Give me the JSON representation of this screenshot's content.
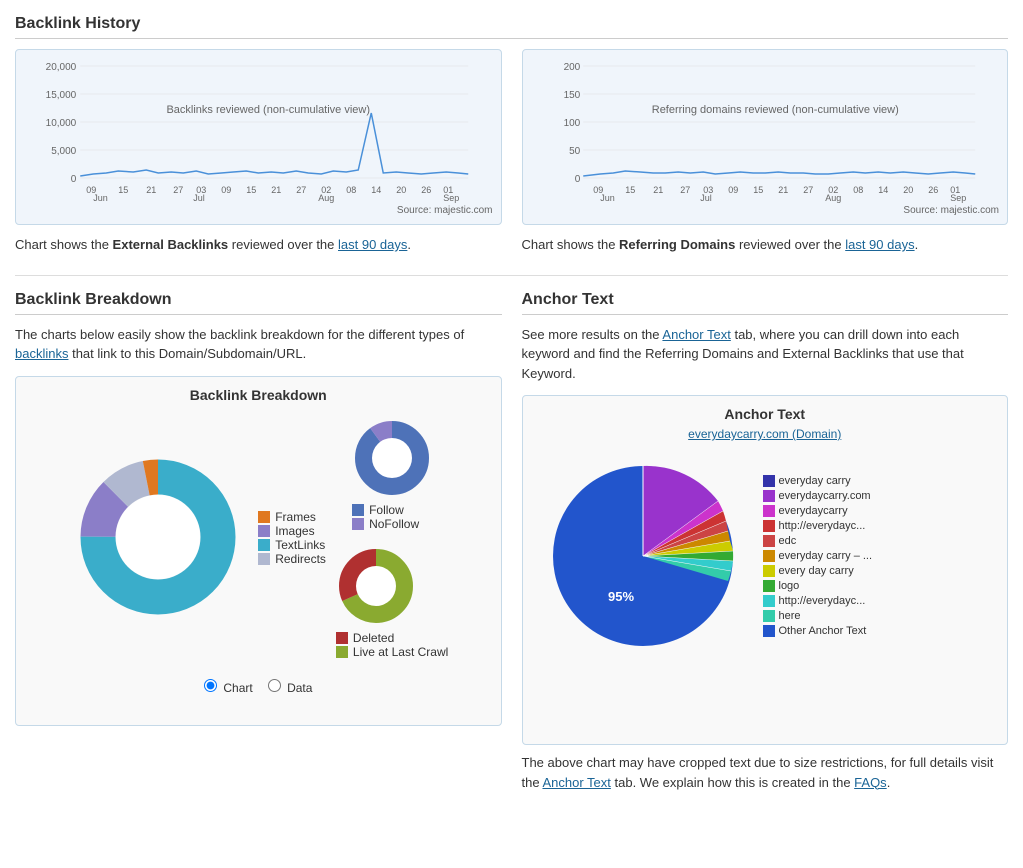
{
  "page": {
    "backlink_history_title": "Backlink History",
    "backlink_breakdown_title": "Backlink Breakdown",
    "anchor_text_title": "Anchor Text",
    "left_chart": {
      "title": "Backlinks reviewed (non-cumulative view)",
      "source": "Source: majestic.com",
      "y_labels": [
        "20,000",
        "15,000",
        "10,000",
        "5,000",
        "0"
      ],
      "desc": "Chart shows the ",
      "desc_bold": "External Backlinks",
      "desc_mid": " reviewed over the ",
      "desc_link": "last 90 days",
      "desc_end": "."
    },
    "right_chart": {
      "title": "Referring domains reviewed (non-cumulative view)",
      "source": "Source: majestic.com",
      "y_labels": [
        "200",
        "150",
        "100",
        "50",
        "0"
      ],
      "desc": "Chart shows the ",
      "desc_bold": "Referring Domains",
      "desc_mid": " reviewed over the ",
      "desc_link": "last 90 days",
      "desc_end": "."
    },
    "breakdown_desc": "The charts below easily show the backlink breakdown for the different types of ",
    "breakdown_link": "backlinks",
    "breakdown_desc2": " that link to this Domain/Subdomain/URL.",
    "anchor_desc": "See more results on the ",
    "anchor_link": "Anchor Text",
    "anchor_desc2": " tab, where you can drill down into each keyword and find the Referring Domains and External Backlinks that use that Keyword.",
    "breakdown_chart_title": "Backlink Breakdown",
    "anchor_chart_title": "Anchor Text",
    "anchor_domain": "everydaycarry.com (Domain)",
    "anchor_percent": "95%",
    "anchor_note": "The above chart may have cropped text due to size restrictions, for full details visit the ",
    "anchor_note_link": "Anchor Text",
    "anchor_note2": " tab. We explain how this is created in the ",
    "anchor_note_link2": "FAQs",
    "anchor_note3": ".",
    "donut_legend": [
      {
        "color": "#e07820",
        "label": "Frames"
      },
      {
        "color": "#8b7ec8",
        "label": "Images"
      },
      {
        "color": "#3aadca",
        "label": "TextLinks"
      },
      {
        "color": "#b0b8d0",
        "label": "Redirects"
      }
    ],
    "follow_legend": [
      {
        "color": "#4e72b8",
        "label": "Follow"
      },
      {
        "color": "#8b7ec8",
        "label": "NoFollow"
      }
    ],
    "status_legend": [
      {
        "color": "#b03030",
        "label": "Deleted"
      },
      {
        "color": "#8aaa30",
        "label": "Live at Last Crawl"
      }
    ],
    "anchor_legend": [
      {
        "color": "#3333aa",
        "label": "everyday carry"
      },
      {
        "color": "#9933cc",
        "label": "everydaycarry.com"
      },
      {
        "color": "#cc33cc",
        "label": "everydaycarry"
      },
      {
        "color": "#cc3333",
        "label": "http://everydayc..."
      },
      {
        "color": "#cc3333",
        "label": "edc"
      },
      {
        "color": "#cc8800",
        "label": "everyday carry – ..."
      },
      {
        "color": "#cccc00",
        "label": "every day carry"
      },
      {
        "color": "#33aa33",
        "label": "logo"
      },
      {
        "color": "#33cccc",
        "label": "http://everydayc..."
      },
      {
        "color": "#33ccaa",
        "label": "here"
      },
      {
        "color": "#3366cc",
        "label": "Other Anchor Text"
      }
    ],
    "radio_chart_label": "Chart",
    "radio_data_label": "Data"
  }
}
